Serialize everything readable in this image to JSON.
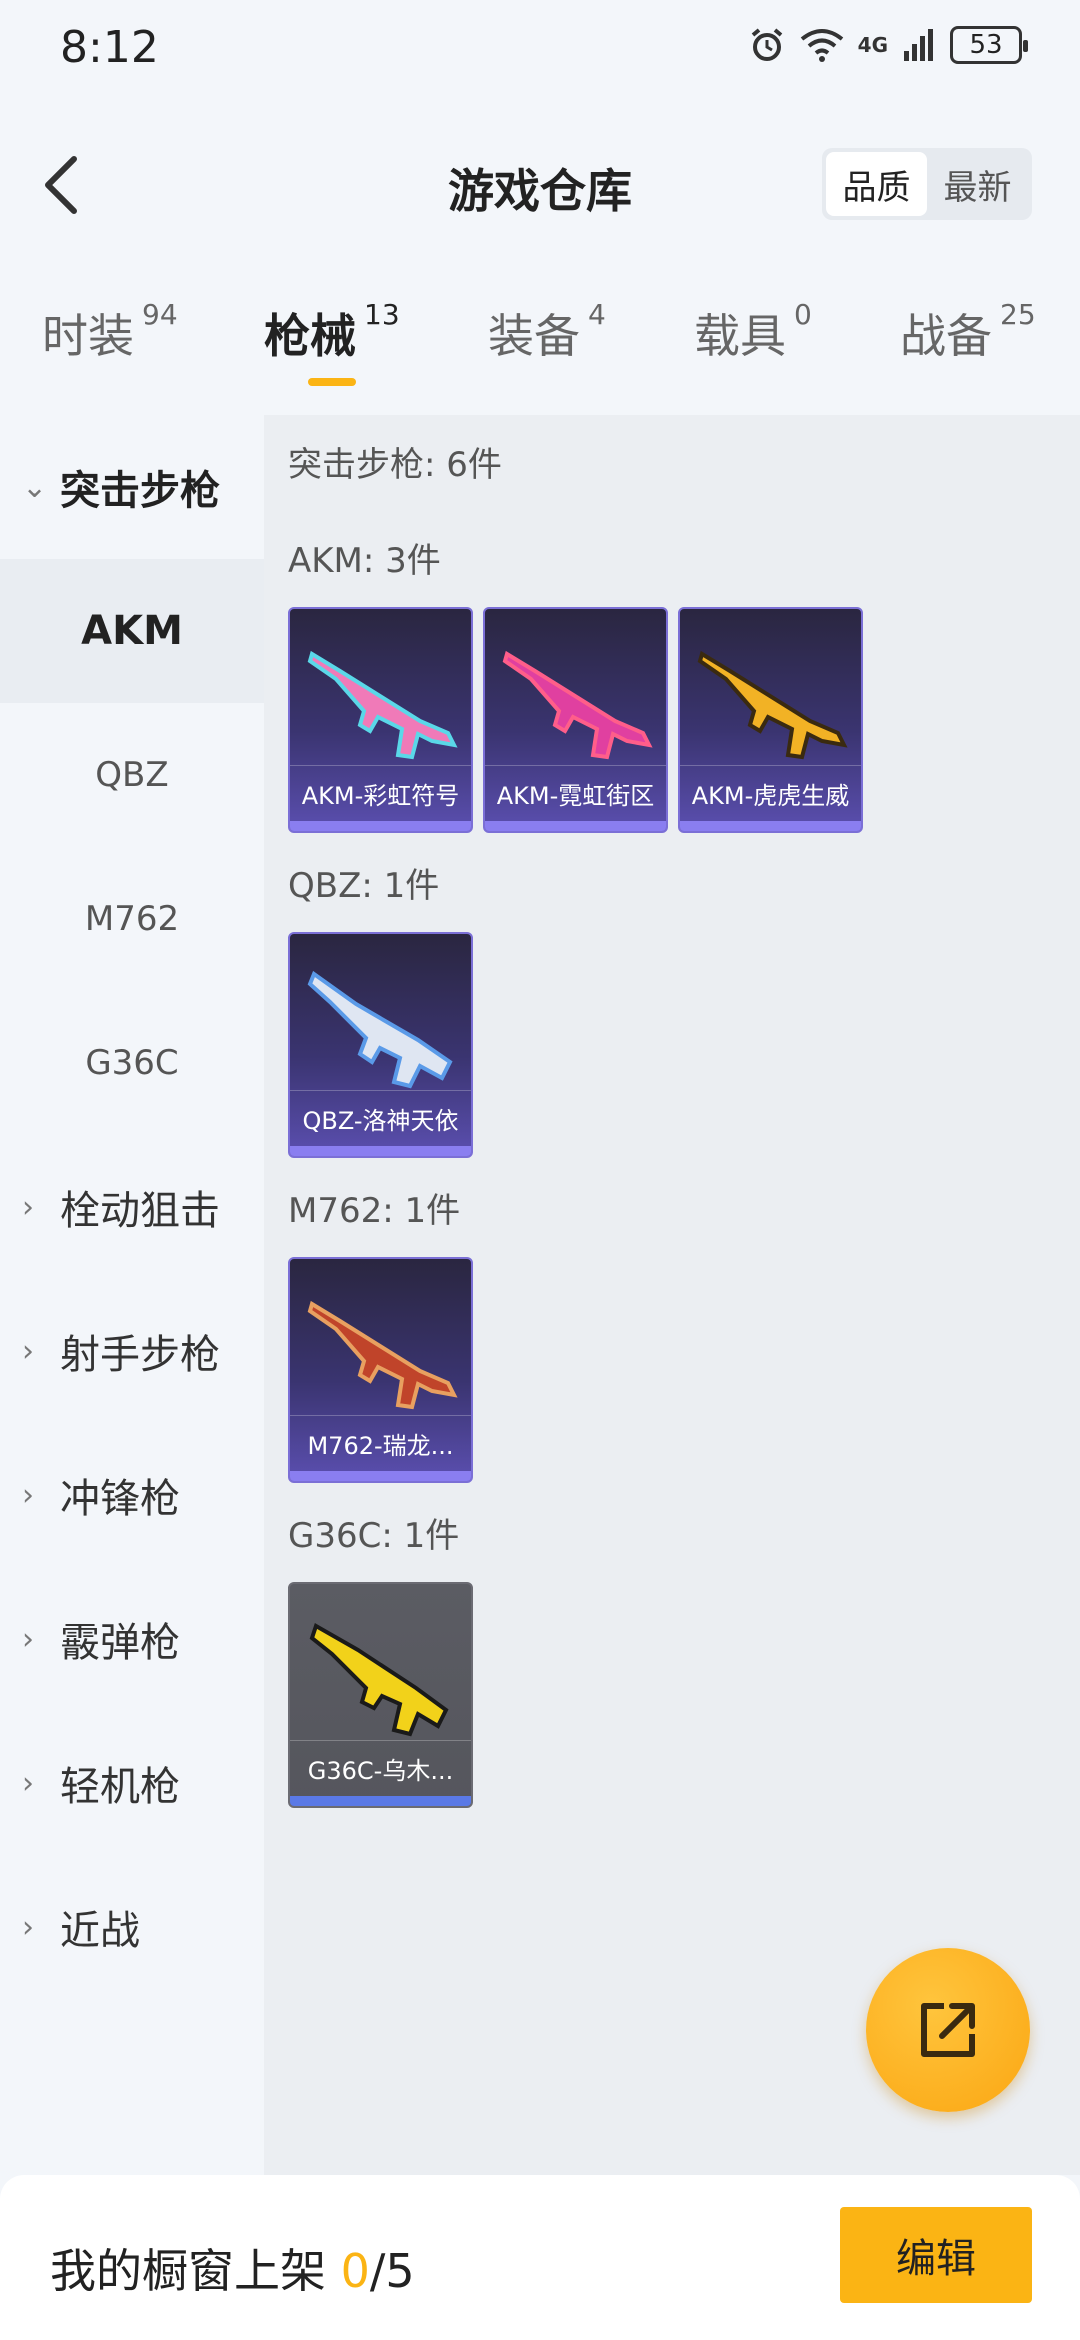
{
  "status_bar": {
    "time": "8:12",
    "network": "4G",
    "battery": "53"
  },
  "header": {
    "title": "游戏仓库",
    "sort_options": [
      "品质",
      "最新"
    ],
    "sort_active": "品质"
  },
  "tabs": [
    {
      "label": "时装",
      "count": "94"
    },
    {
      "label": "枪械",
      "count": "13"
    },
    {
      "label": "装备",
      "count": "4"
    },
    {
      "label": "载具",
      "count": "0"
    },
    {
      "label": "战备",
      "count": "25"
    }
  ],
  "sidebar": {
    "open_category": "突击步枪",
    "sub_items": [
      "AKM",
      "QBZ",
      "M762",
      "G36C"
    ],
    "active_sub": "AKM",
    "categories": [
      "栓动狙击",
      "射手步枪",
      "冲锋枪",
      "霰弹枪",
      "轻机枪",
      "近战"
    ]
  },
  "content": {
    "summary": "突击步枪: 6件",
    "groups": [
      {
        "title": "AKM: 3件",
        "items": [
          {
            "name": "AKM-彩虹符号",
            "colors": [
              "#f07ab8",
              "#5ad8e8"
            ]
          },
          {
            "name": "AKM-霓虹街区",
            "colors": [
              "#e040a0",
              "#ff5e8a"
            ]
          },
          {
            "name": "AKM-虎虎生威",
            "colors": [
              "#f2b225",
              "#3a2a10"
            ]
          }
        ]
      },
      {
        "title": "QBZ: 1件",
        "items": [
          {
            "name": "QBZ-洛神天依",
            "colors": [
              "#dfe6f2",
              "#5a9ae8"
            ]
          }
        ]
      },
      {
        "title": "M762: 1件",
        "items": [
          {
            "name": "M762-瑞龙...",
            "colors": [
              "#c0442a",
              "#e8a060"
            ]
          }
        ]
      },
      {
        "title": "G36C: 1件",
        "items": [
          {
            "name": "G36C-乌木...",
            "colors": [
              "#f2d21a",
              "#1a1a1a"
            ]
          }
        ]
      }
    ]
  },
  "bottom_bar": {
    "showcase_label": "我的橱窗上架",
    "showcase_count": "0",
    "showcase_total": "/5",
    "edit_label": "编辑"
  },
  "colors": {
    "accent": "#fbb414",
    "card_purple": "#5b4fb0",
    "card_grey": "#55565d"
  }
}
